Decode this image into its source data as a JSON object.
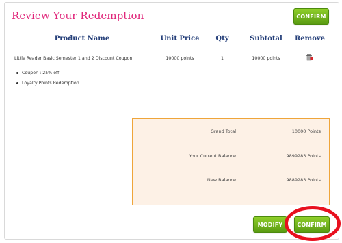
{
  "header": {
    "title": "Review Your Redemption",
    "confirm_label": "CONFIRM"
  },
  "table": {
    "headers": {
      "product": "Product Name",
      "unit_price": "Unit Price",
      "qty": "Qty",
      "subtotal": "Subtotal",
      "remove": "Remove"
    },
    "row": {
      "product": "Little Reader Basic Semester 1 and 2 Discount Coupon",
      "unit_price": "10000 points",
      "qty": "1",
      "subtotal": "10000 points",
      "details": [
        "Coupon : 25% off",
        "Loyalty Points Redemption"
      ]
    }
  },
  "totals": {
    "grand_total_label": "Grand Total",
    "grand_total_value": "10000 Points",
    "current_balance_label": "Your Current Balance",
    "current_balance_value": "9899283 Points",
    "new_balance_label": "New Balance",
    "new_balance_value": "9889283 Points"
  },
  "footer": {
    "modify_label": "MODIFY",
    "confirm_label": "CONFIRM"
  },
  "icons": {
    "remove": "trash-icon"
  },
  "colors": {
    "title": "#e0267a",
    "header_text": "#26407a",
    "button": "#6aab19",
    "totals_border": "#efa53a",
    "totals_bg": "#fdf1e6",
    "highlight": "#e8101e"
  }
}
